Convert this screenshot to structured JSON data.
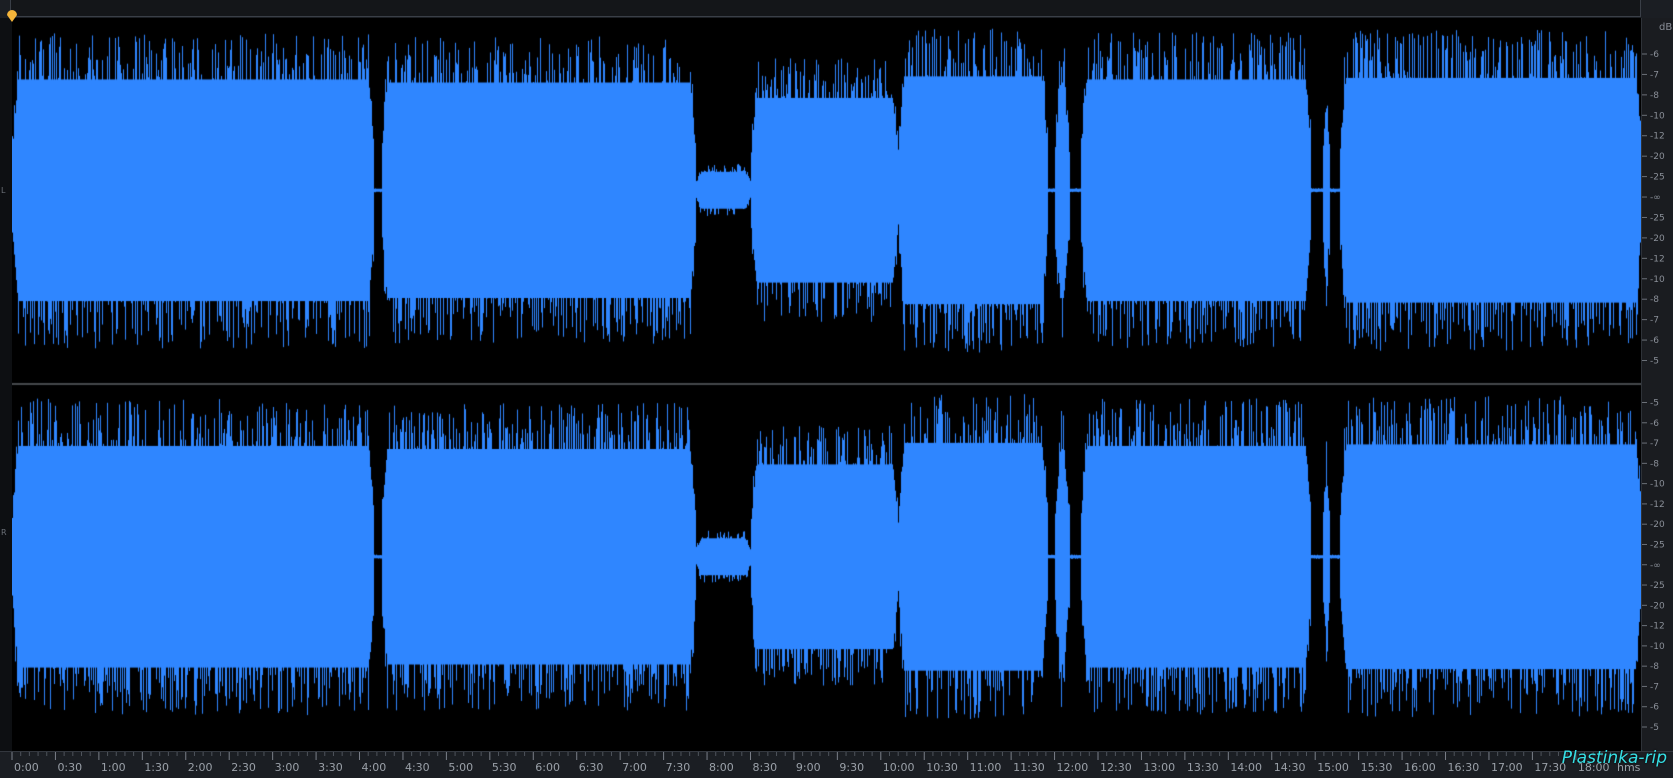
{
  "app": {
    "colors": {
      "waveform": "#2f86ff",
      "background": "#000000",
      "panel": "#1b1e23",
      "playhead": "#f5b53a",
      "watermark": "#36e0e6"
    },
    "channels": [
      {
        "name": "L"
      },
      {
        "name": "R"
      }
    ],
    "db_scale": {
      "unit_label": "dB",
      "ticks": [
        "-6",
        "-7",
        "-8",
        "-10",
        "-12",
        "-20",
        "-25",
        "-∞",
        "-25",
        "-20",
        "-12",
        "-10",
        "-8",
        "-7",
        "-6",
        "-5"
      ],
      "ticks_lower": [
        "-5",
        "-6",
        "-7",
        "-8",
        "-10",
        "-12",
        "-20",
        "-25",
        "-∞",
        "-25",
        "-20",
        "-12",
        "-10",
        "-8",
        "-7",
        "-6",
        "-5"
      ]
    },
    "time_ruler": {
      "labels": [
        "0:00",
        "0:30",
        "1:00",
        "1:30",
        "2:00",
        "2:30",
        "3:00",
        "3:30",
        "4:00",
        "4:30",
        "5:00",
        "5:30",
        "6:00",
        "6:30",
        "7:00",
        "7:30",
        "8:00",
        "8:30",
        "9:00",
        "9:30",
        "10:00",
        "10:30",
        "11:00",
        "11:30",
        "12:00",
        "12:30",
        "13:00",
        "13:30",
        "14:00",
        "14:30",
        "15:00",
        "15:30",
        "16:00",
        "16:30",
        "17:00",
        "17:30",
        "18:00",
        "hms"
      ],
      "range_seconds": [
        0,
        1125
      ]
    },
    "watermark": "Plastinka-rip",
    "segments": [
      {
        "start": 0,
        "end": 250,
        "level": 0.72
      },
      {
        "start": 255,
        "end": 472,
        "level": 0.7
      },
      {
        "start": 472,
        "end": 510,
        "level": 0.12
      },
      {
        "start": 510,
        "end": 612,
        "level": 0.6
      },
      {
        "start": 612,
        "end": 715,
        "level": 0.74
      },
      {
        "start": 720,
        "end": 730,
        "level": 0.7
      },
      {
        "start": 738,
        "end": 897,
        "level": 0.72
      },
      {
        "start": 905,
        "end": 910,
        "level": 0.7
      },
      {
        "start": 917,
        "end": 1125,
        "level": 0.73
      }
    ]
  }
}
